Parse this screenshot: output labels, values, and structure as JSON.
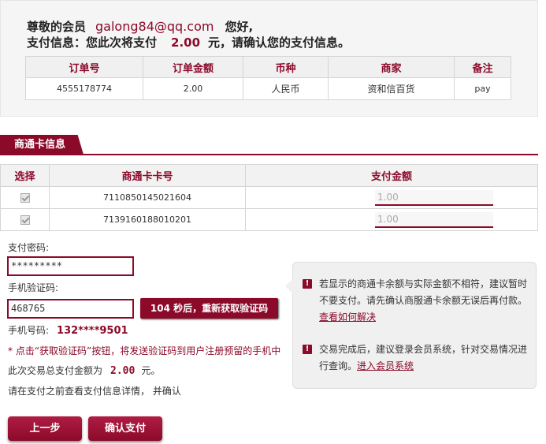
{
  "header": {
    "greeting_prefix": "尊敬的会员",
    "email": "galong84@qq.com",
    "greeting_suffix": "您好,",
    "payinfo_prefix": "支付信息：您此次将支付",
    "pay_amount": "2.00",
    "payinfo_suffix": "元，请确认您的支付信息。"
  },
  "order_table": {
    "columns": [
      "订单号",
      "订单金额",
      "币种",
      "商家",
      "备注"
    ],
    "row": [
      "4555178774",
      "2.00",
      "人民币",
      "资和信百货",
      "pay"
    ]
  },
  "card_section": {
    "title": "商通卡信息",
    "columns": [
      "选择",
      "商通卡卡号",
      "支付金额"
    ],
    "rows": [
      {
        "card_no": "7110850145021604",
        "amount": "1.00"
      },
      {
        "card_no": "7139160188010201",
        "amount": "1.00"
      }
    ]
  },
  "form": {
    "password_label": "支付密码:",
    "password_value": "*********",
    "sms_label": "手机验证码:",
    "sms_value": "468765",
    "sms_button": "104 秒后，重新获取验证码",
    "phone_label": "手机号码:",
    "phone_value": "132****9501",
    "notice": "* 点击“获取验证码”按钮，将发送验证码到用户注册预留的手机中",
    "total_prefix": "此次交易总支付金额为",
    "total_amount": "2.00",
    "total_suffix": "元。",
    "confirm_note": "请在支付之前查看支付信息详情，  并确认"
  },
  "tips": [
    {
      "text": "若显示的商通卡余额与实际金额不相符，建议暂时不要支付。请先确认商服通卡余额无误后再付款。",
      "link": "查看如何解决"
    },
    {
      "text": "交易完成后，建议登录会员系统，针对交易情况进行查询。",
      "link": "进入会员系统"
    }
  ],
  "tip_icon": "!",
  "buttons": {
    "prev": "上一步",
    "confirm": "确认支付"
  },
  "colors": {
    "accent": "#8b0a2a",
    "panel": "#f5f5f5"
  }
}
